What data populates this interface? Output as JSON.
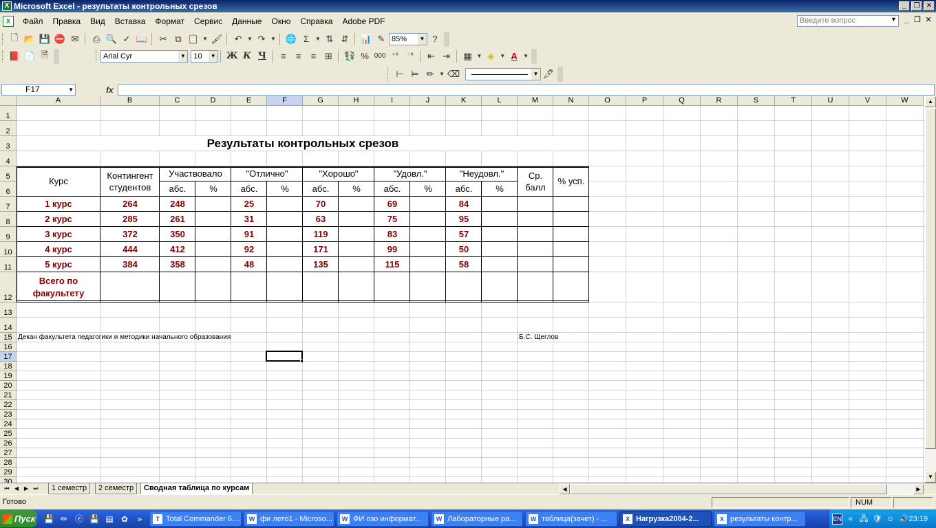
{
  "window": {
    "title": "Microsoft Excel - результаты контрольных срезов"
  },
  "menu": {
    "items": [
      "Файл",
      "Правка",
      "Вид",
      "Вставка",
      "Формат",
      "Сервис",
      "Данные",
      "Окно",
      "Справка",
      "Adobe PDF"
    ],
    "ask_placeholder": "Введите вопрос"
  },
  "toolbar": {
    "zoom": "85%",
    "font_name": "Arial Cyr",
    "font_size": "10",
    "bold": "Ж",
    "italic": "К",
    "underline": "Ч",
    "percent": "%",
    "thousands": "000"
  },
  "formula_bar": {
    "name_box": "F17",
    "fx": "fx",
    "formula": ""
  },
  "columns": [
    "A",
    "B",
    "C",
    "D",
    "E",
    "F",
    "G",
    "H",
    "I",
    "J",
    "K",
    "L",
    "M",
    "N",
    "O",
    "P",
    "Q",
    "R",
    "S",
    "T",
    "U",
    "V",
    "W"
  ],
  "rows": [
    "1",
    "2",
    "3",
    "4",
    "5",
    "6",
    "7",
    "8",
    "9",
    "10",
    "11",
    "12",
    "13",
    "14",
    "15",
    "16",
    "17",
    "18",
    "19",
    "20",
    "21",
    "22",
    "23",
    "24",
    "25",
    "26",
    "27",
    "28",
    "29",
    "30"
  ],
  "sheet": {
    "title": "Результаты контрольных срезов",
    "headers": {
      "course": "Курс",
      "contingent": "Контингент студентов",
      "participated": "Участвовало",
      "excellent": "\"Отлично\"",
      "good": "\"Хорошо\"",
      "satisfactory": "\"Удовл.\"",
      "unsatisfactory": "\"Неудовл.\"",
      "avg_score": "Ср. балл",
      "pct_success": "% усп.",
      "abs": "абс.",
      "pct": "%"
    },
    "data_rows": [
      {
        "course": "1 курс",
        "contingent": "264",
        "participated": "248",
        "excellent": "25",
        "good": "70",
        "satisfactory": "69",
        "unsatisfactory": "84"
      },
      {
        "course": "2 курс",
        "contingent": "285",
        "participated": "261",
        "excellent": "31",
        "good": "63",
        "satisfactory": "75",
        "unsatisfactory": "95"
      },
      {
        "course": "3 курс",
        "contingent": "372",
        "participated": "350",
        "excellent": "91",
        "good": "119",
        "satisfactory": "83",
        "unsatisfactory": "57"
      },
      {
        "course": "4 курс",
        "contingent": "444",
        "participated": "412",
        "excellent": "92",
        "good": "171",
        "satisfactory": "99",
        "unsatisfactory": "50"
      },
      {
        "course": "5 курс",
        "contingent": "384",
        "participated": "358",
        "excellent": "48",
        "good": "135",
        "satisfactory": "115",
        "unsatisfactory": "58"
      }
    ],
    "total_label": "Всего по факультету",
    "dean_text": "Декан факультета педагогики и методики начального образования",
    "signature": "Б.С. Щеглов"
  },
  "tabs": [
    "1 семестр",
    "2 семестр",
    "Сводная таблица по курсам"
  ],
  "status": {
    "ready": "Готово",
    "num": "NUM"
  },
  "taskbar": {
    "start": "Пуск",
    "tasks": [
      "Total Commander 6....",
      "фи лето1 - Microso...",
      "ФИ озо информат...",
      "Лабораторные ра...",
      "таблица(зачет) - ...",
      "Нагрузка2004-2...",
      "результаты контр..."
    ],
    "lang": "EN",
    "clock": "23:19"
  },
  "colors": {
    "data_text": "#800000",
    "title_bar": "#0a246a",
    "taskbar": "#245edb"
  }
}
